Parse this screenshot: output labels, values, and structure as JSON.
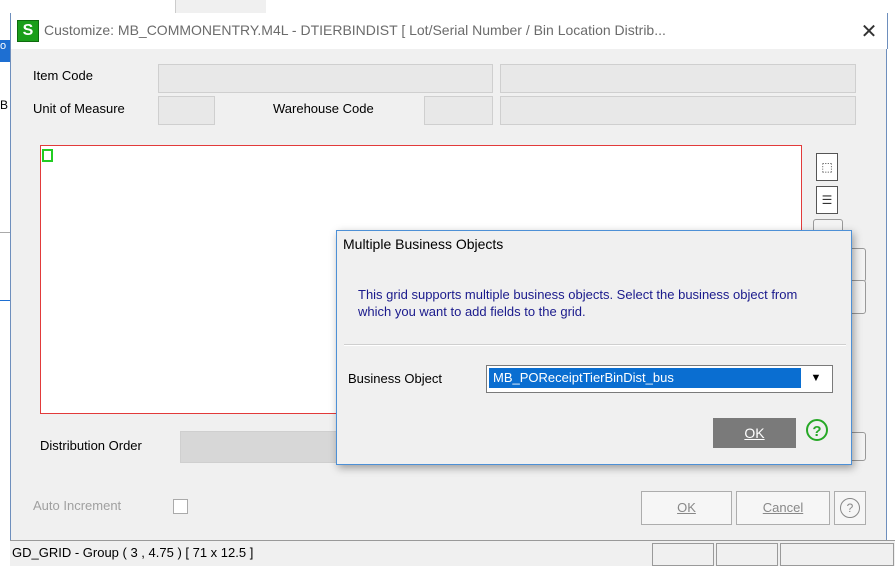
{
  "window": {
    "app_logo": "S",
    "title": "Customize: MB_COMMONENTRY.M4L - DTIERBINDIST  [ Lot/Serial Number / Bin Location Distrib...",
    "close_glyph": "✕"
  },
  "background": {
    "left_fragment_a": "o",
    "left_fragment_b": "B"
  },
  "form": {
    "item_code_label": "Item Code",
    "unit_of_measure_label": "Unit of Measure",
    "warehouse_code_label": "Warehouse Code",
    "distribution_order_label": "Distribution Order",
    "auto_increment_label": "Auto Increment"
  },
  "tools": {
    "icon_a": "⬚",
    "icon_b": "☰"
  },
  "buttons": {
    "ok_label": "OK",
    "cancel_label": "Cancel",
    "help_glyph": "?"
  },
  "status": {
    "text": "GD_GRID - Group  ( 3 , 4.75 )  [ 71 x 12.5 ]"
  },
  "dialog": {
    "title": "Multiple Business Objects",
    "message": "This grid supports multiple business objects.  Select the business object from which you want to add fields to the grid.",
    "business_object_label": "Business Object",
    "business_object_value": "MB_POReceiptTierBinDist_bus",
    "dropdown_glyph": "▼",
    "ok_label": "OK",
    "help_glyph": "?"
  },
  "colors": {
    "accent_blue": "#0a6ed1",
    "grid_border_red": "#e23a3a",
    "sage_green": "#1a9e1a",
    "dialog_text_navy": "#1a1a8c"
  }
}
